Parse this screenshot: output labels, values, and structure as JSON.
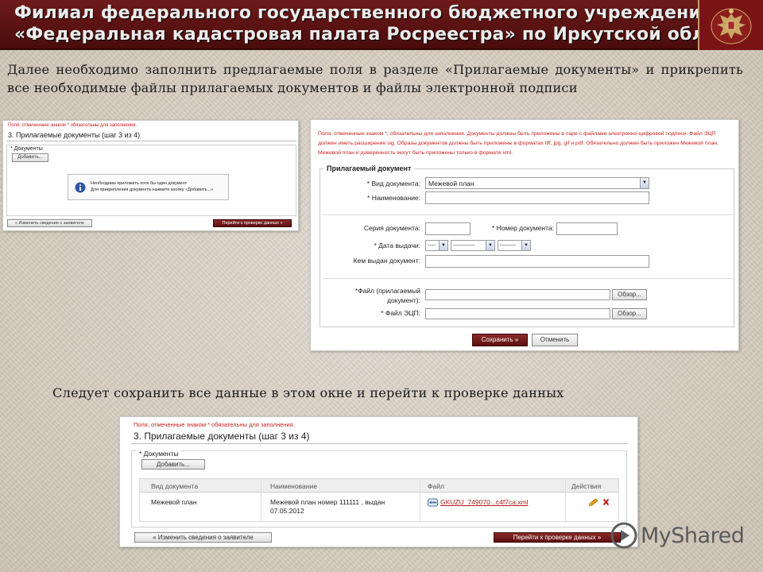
{
  "header": {
    "line1": "Филиал федерального государственного бюджетного учреждения",
    "line2": "«Федеральная кадастровая палата Росреестра» по Иркутской области"
  },
  "intro_text": "Далее необходимо заполнить предлагаемые поля в разделе «Прилагаемые документы» и прикрепить все необходимые файлы прилагаемых документов и файлы электронной подписи",
  "caption_text": "Следует сохранить все данные в этом окне и перейти к проверке данных",
  "shot1": {
    "note": "Поля, отмеченные знаком * обязательны для заполнения.",
    "step_title": "3. Прилагаемые документы (шаг 3 из 4)",
    "section_label": "* Документы",
    "add_button": "Добавить...",
    "info_line1": "Необходимо приложить хотя бы один документ",
    "info_line2": "Для прикрепления документа нажмите кнопку «Добавить...»",
    "back_button": "« Изменить сведения о заявителе",
    "next_button": "Перейти к проверке данных »"
  },
  "shot2": {
    "note": "Поля, отмеченные знаком *, обязательны для заполнения. Документы должны быть приложены в паре с файлами электронно-цифровой подписи. Файл ЭЦП должен иметь расширение sig. Образы документов должны быть приложены в форматах tiff, jpg, gif и pdf. Обязательно должен быть приложен Межевой план. Межевой план и доверенность могут быть приложены только в формате xml.",
    "legend": "Прилагаемый документ",
    "doc_type_label": "* Вид документа:",
    "doc_type_value": "Межевой план",
    "name_label": "* Наименование:",
    "series_label": "Серия документа:",
    "number_label": "* Номер документа:",
    "date_label": "* Дата выдачи:",
    "date_day": "----",
    "date_month": "-----------",
    "date_year": "--------",
    "issuer_label": "Кем выдан документ:",
    "file_label_1": "*Файл (прилагаемый",
    "file_label_2": "документ):",
    "sig_label": "* Файл ЭЦП:",
    "browse_1": "Обзор...",
    "browse_2": "Обзор...",
    "save_button": "Сохранить »",
    "cancel_button": "Отменить"
  },
  "shot3": {
    "note": "Поля, отмеченные знаком * обязательны для заполнения.",
    "step_title": "3. Прилагаемые документы (шаг 3 из 4)",
    "section_label": "* Документы",
    "add_button": "Добавить...",
    "columns": [
      "Вид документа",
      "Наименование",
      "Файл",
      "Действия"
    ],
    "row": {
      "type": "Межевой план",
      "name_line1": "Межевой план номер 111111 , выдан",
      "name_line2": "07.05.2012",
      "file": "GKUZU_749070...c4f7ca.xml"
    },
    "back_button": "« Изменить сведения о заявителе",
    "next_button": "Перейти к проверке данных »"
  },
  "watermark": "MyShared",
  "colors": {
    "header_bg": "#5e1212",
    "accent_dark_red": "#6b1414",
    "note_red": "#cc2020",
    "link_red": "#b01c1c"
  }
}
